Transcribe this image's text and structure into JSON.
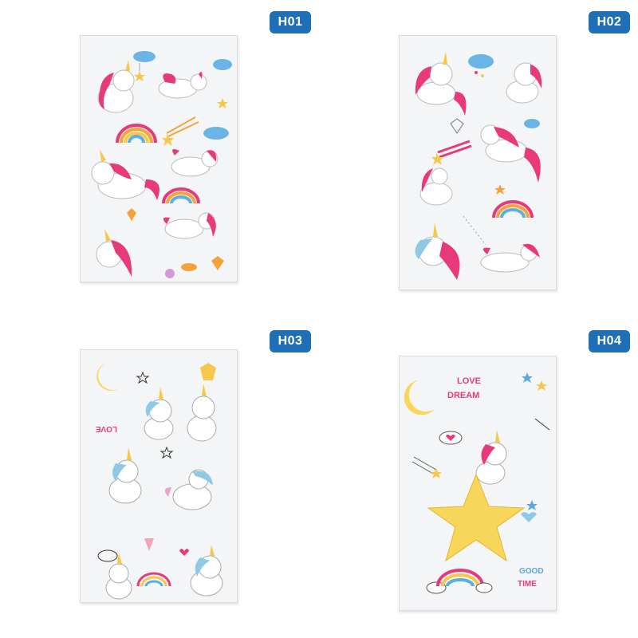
{
  "labels": {
    "h01": "H01",
    "h02": "H02",
    "h03": "H03",
    "h04": "H04"
  },
  "sticker_text": {
    "h03_love": "LOVE",
    "h04_love": "LOVE",
    "h04_dream": "DREAM",
    "h04_good": "GOOD",
    "h04_time": "TIME"
  },
  "colors": {
    "badge": "#1e6fb6",
    "unicorn_mane_pink": "#e8397a",
    "unicorn_mane_blue": "#8ecae6",
    "star_yellow": "#f6c84a",
    "moon_yellow": "#f8d659",
    "cloud_blue": "#6bb5e6"
  }
}
